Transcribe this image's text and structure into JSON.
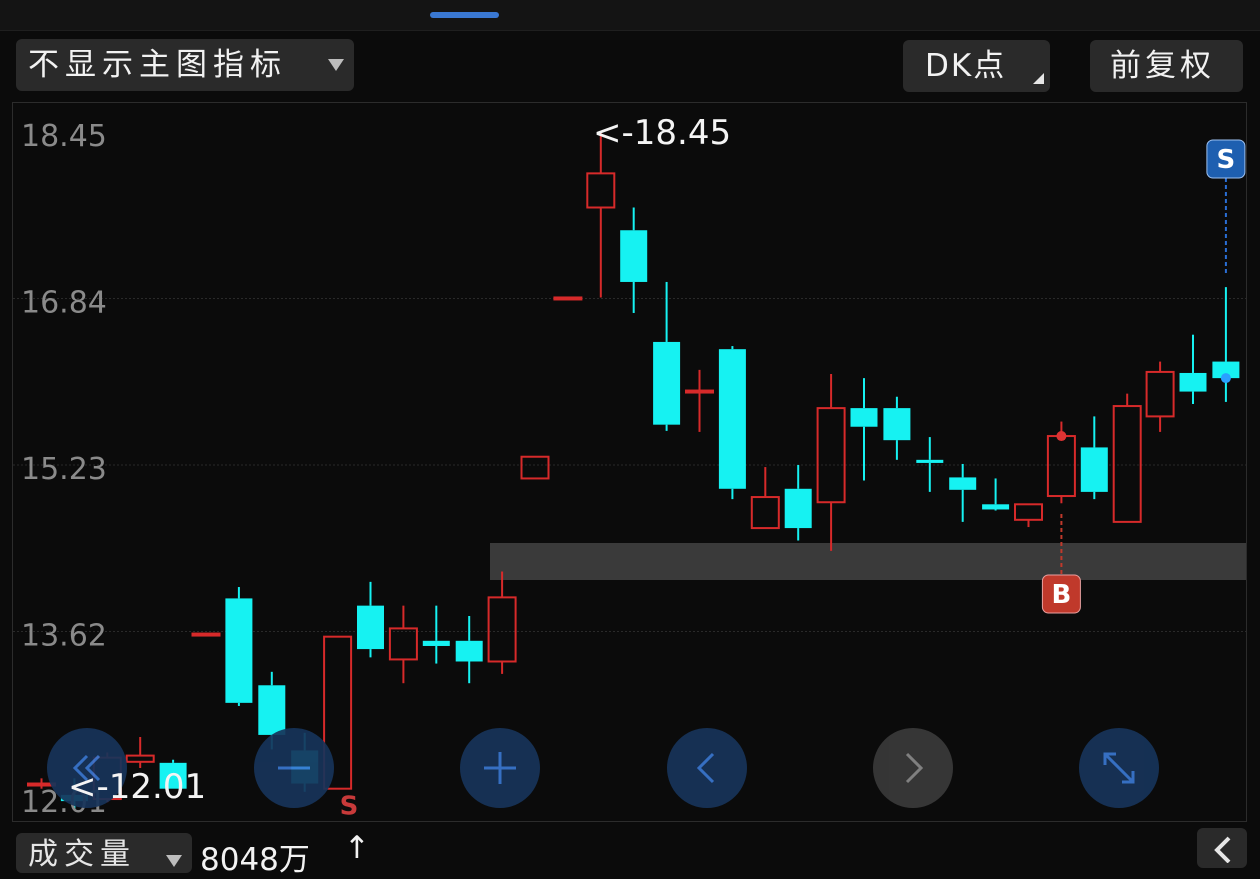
{
  "toolbar": {
    "indicator_select": "不显示主图指标",
    "dk_button": "DK点",
    "adjust_button": "前复权"
  },
  "chart_data": {
    "type": "candlestick",
    "y_ticks": [
      "18.45",
      "16.84",
      "15.23",
      "13.62",
      "12.01"
    ],
    "ylim": [
      12.01,
      18.45
    ],
    "grid": true,
    "max_label": "<-18.45",
    "min_label": "<-12.01",
    "signals": [
      {
        "type": "S",
        "color": "#c83a3a",
        "candle": 9
      },
      {
        "type": "B",
        "color": "#c0392b",
        "candle": 31
      },
      {
        "type": "S",
        "color": "#1e5fb0",
        "candle": 36
      }
    ],
    "candles": [
      {
        "o": 12.15,
        "c": 12.15,
        "h": 12.2,
        "l": 12.1,
        "color": "red"
      },
      {
        "o": 12.04,
        "c": 11.98,
        "h": 12.2,
        "l": 11.9,
        "color": "cyan"
      },
      {
        "o": 12.0,
        "c": 12.4,
        "h": 12.45,
        "l": 11.97,
        "color": "red"
      },
      {
        "o": 12.36,
        "c": 12.42,
        "h": 12.6,
        "l": 12.3,
        "color": "red"
      },
      {
        "o": 12.35,
        "c": 12.1,
        "h": 12.38,
        "l": 12.1,
        "color": "cyan"
      },
      {
        "o": 13.6,
        "c": 13.6,
        "h": 13.6,
        "l": 13.6,
        "color": "red"
      },
      {
        "o": 13.94,
        "c": 12.93,
        "h": 14.05,
        "l": 12.9,
        "color": "cyan"
      },
      {
        "o": 13.1,
        "c": 12.62,
        "h": 13.23,
        "l": 12.48,
        "color": "cyan"
      },
      {
        "o": 12.47,
        "c": 12.15,
        "h": 12.64,
        "l": 12.07,
        "color": "cyan"
      },
      {
        "o": 12.1,
        "c": 13.57,
        "h": 13.57,
        "l": 12.1,
        "color": "red"
      },
      {
        "o": 13.87,
        "c": 13.45,
        "h": 14.1,
        "l": 13.37,
        "color": "cyan"
      },
      {
        "o": 13.35,
        "c": 13.65,
        "h": 13.87,
        "l": 13.12,
        "color": "red"
      },
      {
        "o": 13.53,
        "c": 13.48,
        "h": 13.87,
        "l": 13.31,
        "color": "cyan"
      },
      {
        "o": 13.53,
        "c": 13.33,
        "h": 13.77,
        "l": 13.12,
        "color": "cyan"
      },
      {
        "o": 13.33,
        "c": 13.95,
        "h": 14.2,
        "l": 13.21,
        "color": "red"
      },
      {
        "o": 15.1,
        "c": 15.31,
        "h": 15.31,
        "l": 15.1,
        "color": "red"
      },
      {
        "o": 16.85,
        "c": 16.85,
        "h": 16.85,
        "l": 16.85,
        "color": "red"
      },
      {
        "o": 17.72,
        "c": 18.05,
        "h": 18.45,
        "l": 16.85,
        "color": "red"
      },
      {
        "o": 17.5,
        "c": 17.0,
        "h": 17.72,
        "l": 16.7,
        "color": "cyan"
      },
      {
        "o": 16.42,
        "c": 15.62,
        "h": 17.0,
        "l": 15.56,
        "color": "cyan"
      },
      {
        "o": 15.95,
        "c": 15.95,
        "h": 16.15,
        "l": 15.55,
        "color": "red"
      },
      {
        "o": 16.35,
        "c": 15.0,
        "h": 16.38,
        "l": 14.9,
        "color": "cyan"
      },
      {
        "o": 14.62,
        "c": 14.92,
        "h": 15.21,
        "l": 14.62,
        "color": "red"
      },
      {
        "o": 15.0,
        "c": 14.62,
        "h": 15.23,
        "l": 14.5,
        "color": "cyan"
      },
      {
        "o": 14.87,
        "c": 15.78,
        "h": 16.11,
        "l": 14.4,
        "color": "red"
      },
      {
        "o": 15.78,
        "c": 15.6,
        "h": 16.07,
        "l": 15.08,
        "color": "cyan"
      },
      {
        "o": 15.78,
        "c": 15.47,
        "h": 15.89,
        "l": 15.28,
        "color": "cyan"
      },
      {
        "o": 15.28,
        "c": 15.25,
        "h": 15.5,
        "l": 14.97,
        "color": "cyan"
      },
      {
        "o": 15.11,
        "c": 14.99,
        "h": 15.24,
        "l": 14.68,
        "color": "cyan"
      },
      {
        "o": 14.85,
        "c": 14.8,
        "h": 15.1,
        "l": 14.79,
        "color": "cyan"
      },
      {
        "o": 14.7,
        "c": 14.85,
        "h": 14.85,
        "l": 14.63,
        "color": "red"
      },
      {
        "o": 14.93,
        "c": 15.51,
        "h": 15.65,
        "l": 14.86,
        "color": "red"
      },
      {
        "o": 15.4,
        "c": 14.97,
        "h": 15.7,
        "l": 14.9,
        "color": "cyan"
      },
      {
        "o": 14.68,
        "c": 15.8,
        "h": 15.92,
        "l": 14.68,
        "color": "red"
      },
      {
        "o": 15.7,
        "c": 16.13,
        "h": 16.23,
        "l": 15.55,
        "color": "red"
      },
      {
        "o": 16.12,
        "c": 15.94,
        "h": 16.49,
        "l": 15.82,
        "color": "cyan"
      },
      {
        "o": 16.23,
        "c": 16.07,
        "h": 16.95,
        "l": 15.84,
        "color": "cyan"
      }
    ]
  },
  "nav_buttons": [
    {
      "name": "first-page-button",
      "icon": "double-chevron-left-icon",
      "enabled": true
    },
    {
      "name": "zoom-out-button",
      "icon": "minus-icon",
      "enabled": true
    },
    {
      "name": "zoom-in-button",
      "icon": "plus-icon",
      "enabled": true
    },
    {
      "name": "prev-button",
      "icon": "chevron-left-icon",
      "enabled": true
    },
    {
      "name": "next-button",
      "icon": "chevron-right-icon",
      "enabled": false
    },
    {
      "name": "fullscreen-button",
      "icon": "expand-icon",
      "enabled": true
    }
  ],
  "volume": {
    "select_label": "成交量",
    "value": "8048万",
    "arrow": "↑"
  },
  "colors": {
    "up": "#d72a2a",
    "down": "#16f2f2",
    "accent": "#3a78d2"
  }
}
